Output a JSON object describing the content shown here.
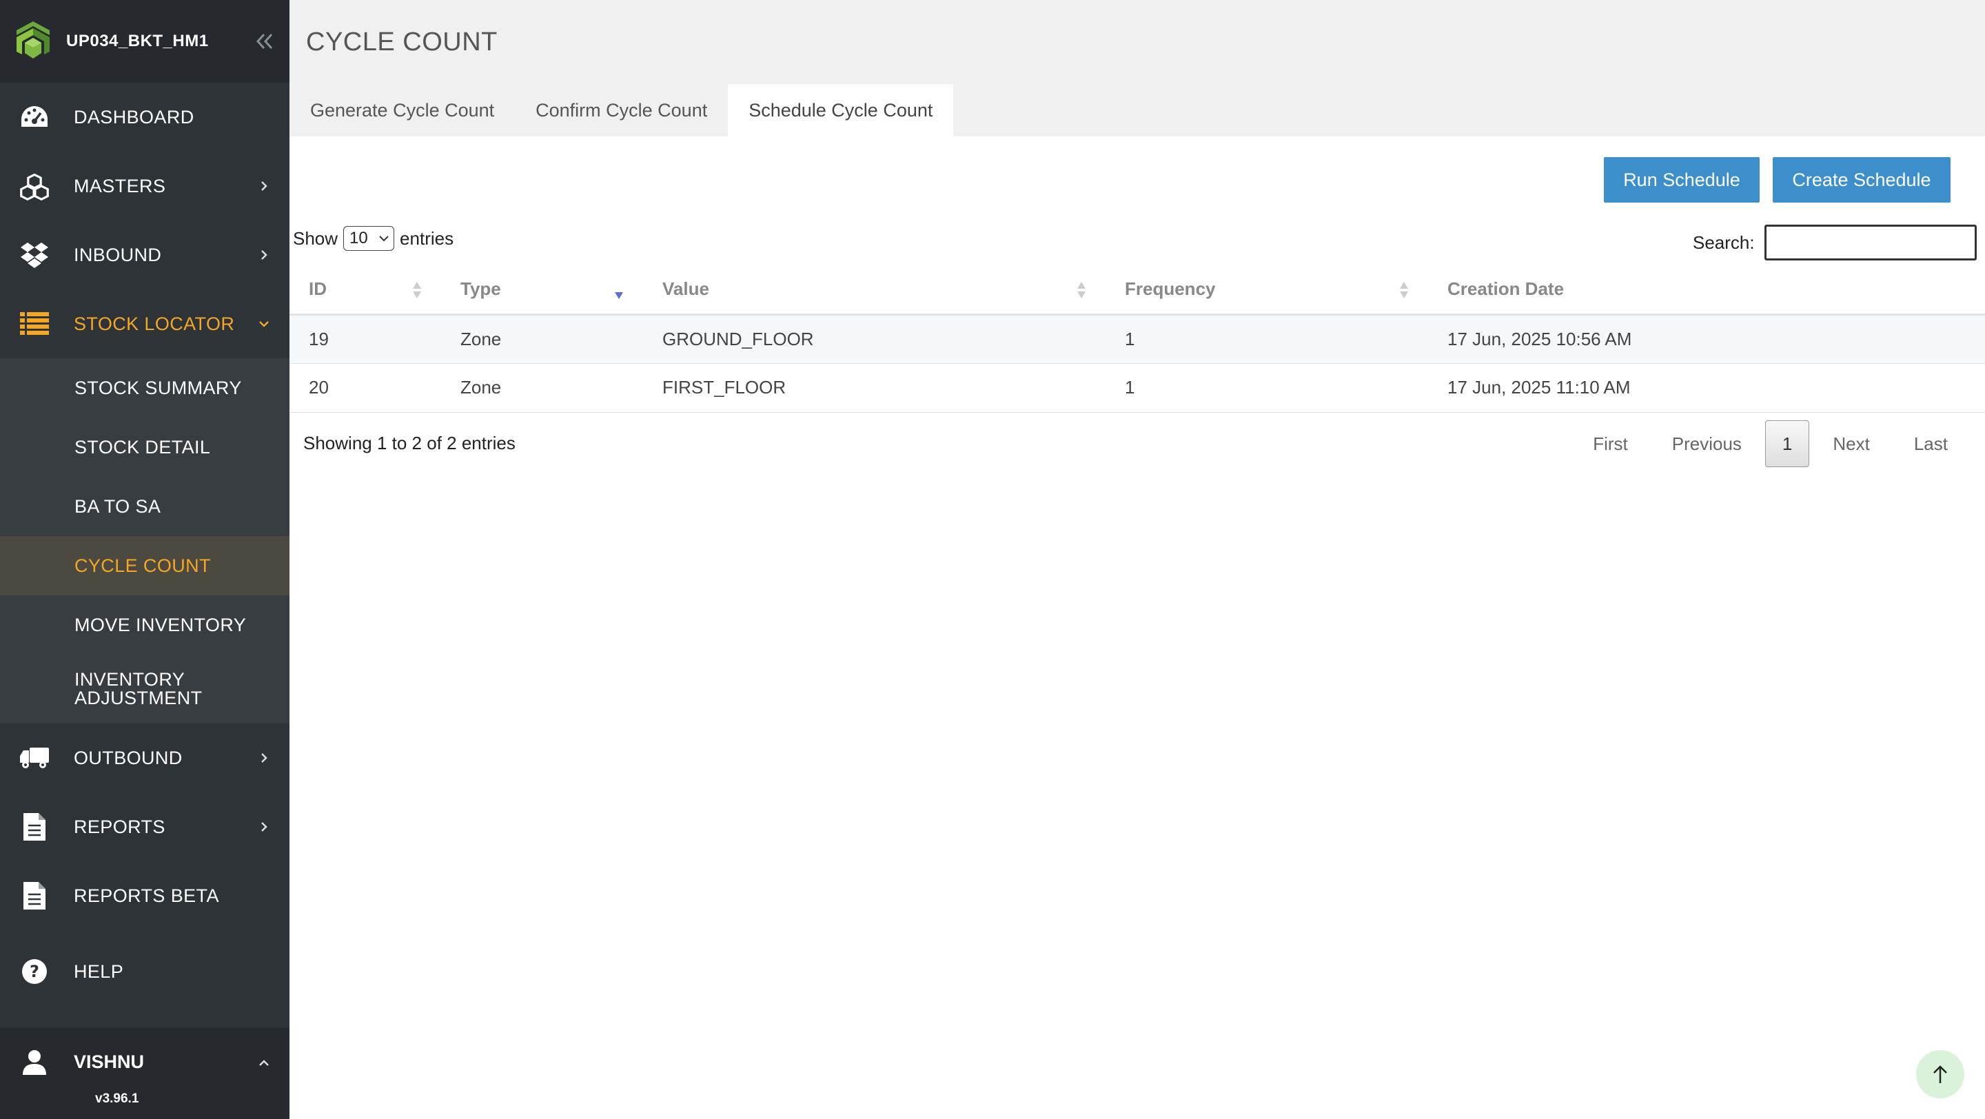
{
  "sidebar": {
    "brand": "UP034_BKT_HM1",
    "nav": {
      "dashboard": "DASHBOARD",
      "masters": "MASTERS",
      "inbound": "INBOUND",
      "stock_locator": "STOCK LOCATOR",
      "outbound": "OUTBOUND",
      "reports": "REPORTS",
      "reports_beta": "REPORTS BETA",
      "help": "HELP"
    },
    "submenu": {
      "stock_summary": "STOCK SUMMARY",
      "stock_detail": "STOCK DETAIL",
      "ba_to_sa": "BA TO SA",
      "cycle_count": "CYCLE COUNT",
      "move_inventory": "MOVE INVENTORY",
      "inventory_adjustment_1": "INVENTORY",
      "inventory_adjustment_2": "ADJUSTMENT"
    },
    "user": "VISHNU",
    "version": "v3.96.1",
    "accent_color": "#f5a623"
  },
  "main": {
    "title": "CYCLE COUNT",
    "tabs": [
      "Generate Cycle Count",
      "Confirm Cycle Count",
      "Schedule Cycle Count"
    ],
    "active_tab": "Schedule Cycle Count",
    "buttons": {
      "run": "Run Schedule",
      "create": "Create Schedule",
      "color": "#3d8fcc"
    },
    "length": {
      "show": "Show",
      "value": "10",
      "entries": "entries"
    },
    "search_label": "Search:",
    "search_value": "",
    "table": {
      "columns": [
        "ID",
        "Type",
        "Value",
        "Frequency",
        "Creation Date"
      ],
      "rows": [
        [
          "19",
          "Zone",
          "GROUND_FLOOR",
          "1",
          "17 Jun, 2025 10:56 AM"
        ],
        [
          "20",
          "Zone",
          "FIRST_FLOOR",
          "1",
          "17 Jun, 2025 11:10 AM"
        ]
      ]
    },
    "info": "Showing 1 to 2 of 2 entries",
    "pager": {
      "first": "First",
      "previous": "Previous",
      "current": "1",
      "next": "Next",
      "last": "Last"
    }
  }
}
